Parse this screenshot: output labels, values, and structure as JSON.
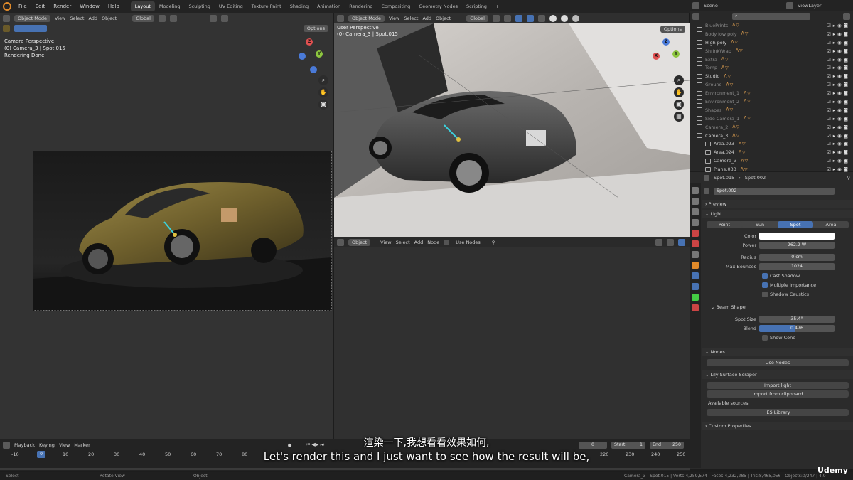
{
  "menu": [
    "File",
    "Edit",
    "Render",
    "Window",
    "Help"
  ],
  "workspaces": [
    "Layout",
    "Modeling",
    "Sculpting",
    "UV Editing",
    "Texture Paint",
    "Shading",
    "Animation",
    "Rendering",
    "Compositing",
    "Geometry Nodes",
    "Scripting"
  ],
  "scene": "Scene",
  "viewlayer": "ViewLayer",
  "left_vp": {
    "mode": "Object Mode",
    "menus": [
      "View",
      "Select",
      "Add",
      "Object"
    ],
    "transform": "Global",
    "options": "Options",
    "info": [
      "Camera Perspective",
      "(0) Camera_3 | Spot.015",
      "Rendering Done"
    ]
  },
  "right_vp": {
    "mode": "Object Mode",
    "menus": [
      "View",
      "Select",
      "Add",
      "Object"
    ],
    "transform": "Global",
    "options": "Options",
    "info": [
      "User Perspective",
      "(0) Camera_3 | Spot.015"
    ]
  },
  "node_hdr": {
    "obj": "Object",
    "menus": [
      "View",
      "Select",
      "Add",
      "Node"
    ],
    "use_nodes": "Use Nodes"
  },
  "outliner": [
    {
      "name": "BluePrints",
      "dim": true
    },
    {
      "name": "Body low poly",
      "dim": true
    },
    {
      "name": "High poly",
      "dim": false
    },
    {
      "name": "ShrinkWrap",
      "dim": true
    },
    {
      "name": "Extra",
      "dim": true
    },
    {
      "name": "Temp",
      "dim": true
    },
    {
      "name": "Studio",
      "dim": false
    },
    {
      "name": "Ground",
      "dim": true
    },
    {
      "name": "Environment_1",
      "dim": true
    },
    {
      "name": "Environment_2",
      "dim": true
    },
    {
      "name": "Shapes",
      "dim": true
    },
    {
      "name": "Side Camera_1",
      "dim": true
    },
    {
      "name": "Camera_2",
      "dim": true
    },
    {
      "name": "Camera_3",
      "dim": false
    },
    {
      "name": "Area.023",
      "dim": false
    },
    {
      "name": "Area.024",
      "dim": false
    },
    {
      "name": "Camera_3",
      "dim": false
    },
    {
      "name": "Plane.033",
      "dim": false
    }
  ],
  "props": {
    "breadcrumb_obj": "Spot.015",
    "breadcrumb_data": "Spot.002",
    "datablock": "Spot.002",
    "preview": "Preview",
    "light": "Light",
    "types": [
      "Point",
      "Sun",
      "Spot",
      "Area"
    ],
    "color_lbl": "Color",
    "power_lbl": "Power",
    "power": "262.2 W",
    "radius_lbl": "Radius",
    "radius": "0 cm",
    "bounces_lbl": "Max Bounces",
    "bounces": "1024",
    "cast_shadow": "Cast Shadow",
    "mult_imp": "Multiple Importance",
    "shadow_caustics": "Shadow Caustics",
    "beam": "Beam Shape",
    "spot_size_lbl": "Spot Size",
    "spot_size": "35.4°",
    "blend_lbl": "Blend",
    "blend": "0.476",
    "show_cone": "Show Cone",
    "nodes": "Nodes",
    "use_nodes": "Use Nodes",
    "lily": "Lily Surface Scraper",
    "import_light": "Import light",
    "import_clip": "Import from clipboard",
    "avail": "Available sources:",
    "ies": "IES Library",
    "custom": "Custom Properties"
  },
  "timeline": {
    "menus": [
      "Playback",
      "Keying",
      "View",
      "Marker"
    ],
    "frame": "0",
    "start_lbl": "Start",
    "start": "1",
    "end_lbl": "End",
    "end": "250",
    "ticks": [
      "-10",
      "0",
      "10",
      "20",
      "30",
      "40",
      "50",
      "60",
      "70",
      "80",
      "220",
      "230",
      "240",
      "250"
    ]
  },
  "status": {
    "select": "Select",
    "rotate": "Rotate View",
    "object": "Object",
    "stats": "Camera_3 | Spot.015 | Verts:4,259,574 | Faces:4,232,285 | Tris:8,465,056 | Objects:0/247 | 4.0"
  },
  "subtitle_cn": "渲染一下,我想看看效果如何,",
  "subtitle_en": "Let's render this and I just want to see how the result will be,",
  "watermark": "Udemy",
  "colors": {
    "accent": "#4772b3",
    "orange": "#e08a2a"
  }
}
